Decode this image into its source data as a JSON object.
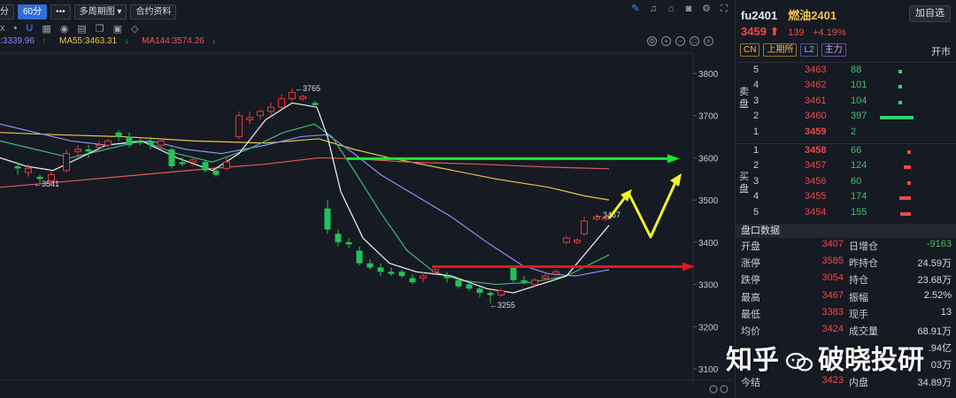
{
  "toolbar": {
    "partial_tab": "分",
    "active_tab": "60分",
    "more": "•••",
    "multi_period": "多周期图",
    "contract_info": "合约资料"
  },
  "ma": {
    "ma1": "3339.96",
    "ma55": "MA55:3463.31",
    "ma144": "MA144:3574.26",
    "ma1_color": "#9c7cf5",
    "ma55_color": "#e8c547",
    "ma144_color": "#e05a5a"
  },
  "price_axis": [
    "3800",
    "3700",
    "3600",
    "3500",
    "3400",
    "3300",
    "3200",
    "3100"
  ],
  "annotations": {
    "high": "←3765",
    "low": "←3255",
    "left": "←3541",
    "last": "←3467"
  },
  "panel": {
    "symbol": "fu2401",
    "name": "燃油2401",
    "add_button": "加自选",
    "last_price": "3459",
    "change": "139",
    "change_pct": "+4.19%",
    "tags": [
      "CN",
      "上期所",
      "L2",
      "主力"
    ],
    "status": "开市",
    "sell_label": "卖盘",
    "buy_label": "买盘",
    "asks": [
      {
        "lv": "5",
        "price": "3463",
        "vol": "88",
        "bar": 0.07
      },
      {
        "lv": "4",
        "price": "3462",
        "vol": "101",
        "bar": 0.07
      },
      {
        "lv": "3",
        "price": "3461",
        "vol": "104",
        "bar": 0.07
      },
      {
        "lv": "2",
        "price": "3460",
        "vol": "397",
        "bar": 0.9
      },
      {
        "lv": "1",
        "price": "3459",
        "vol": "2",
        "bar": 0
      }
    ],
    "bids": [
      {
        "lv": "1",
        "price": "3458",
        "vol": "66",
        "bar": 0.07
      },
      {
        "lv": "2",
        "price": "3457",
        "vol": "124",
        "bar": 0.2
      },
      {
        "lv": "3",
        "price": "3456",
        "vol": "60",
        "bar": 0.07
      },
      {
        "lv": "4",
        "price": "3455",
        "vol": "174",
        "bar": 0.3
      },
      {
        "lv": "5",
        "price": "3454",
        "vol": "155",
        "bar": 0.28
      }
    ],
    "section_title": "盘口数据",
    "stats": [
      {
        "k1": "开盘",
        "v1": "3407",
        "k2": "日增仓",
        "v2": "-9163",
        "v2class": "neg"
      },
      {
        "k1": "涨停",
        "v1": "3585",
        "k2": "昨持仓",
        "v2": "24.59万",
        "v2class": ""
      },
      {
        "k1": "跌停",
        "v1": "3054",
        "k2": "持仓",
        "v2": "23.68万",
        "v2class": ""
      },
      {
        "k1": "最高",
        "v1": "3467",
        "k2": "振幅",
        "v2": "2.52%",
        "v2class": ""
      },
      {
        "k1": "最低",
        "v1": "3383",
        "k2": "现手",
        "v2": "13",
        "v2class": ""
      },
      {
        "k1": "均价",
        "v1": "3424",
        "k2": "成交量",
        "v2": "68.91万",
        "v2class": ""
      },
      {
        "k1": "",
        "v1": "",
        "k2": "",
        "v2": ".94亿",
        "v2class": ""
      },
      {
        "k1": "",
        "v1": "",
        "k2": "",
        "v2": "03万",
        "v2class": ""
      },
      {
        "k1": "今结",
        "v1": "3423",
        "k2": "内盘",
        "v2": "34.89万",
        "v2class": ""
      }
    ]
  },
  "watermark": "知乎 @破晓投研"
}
